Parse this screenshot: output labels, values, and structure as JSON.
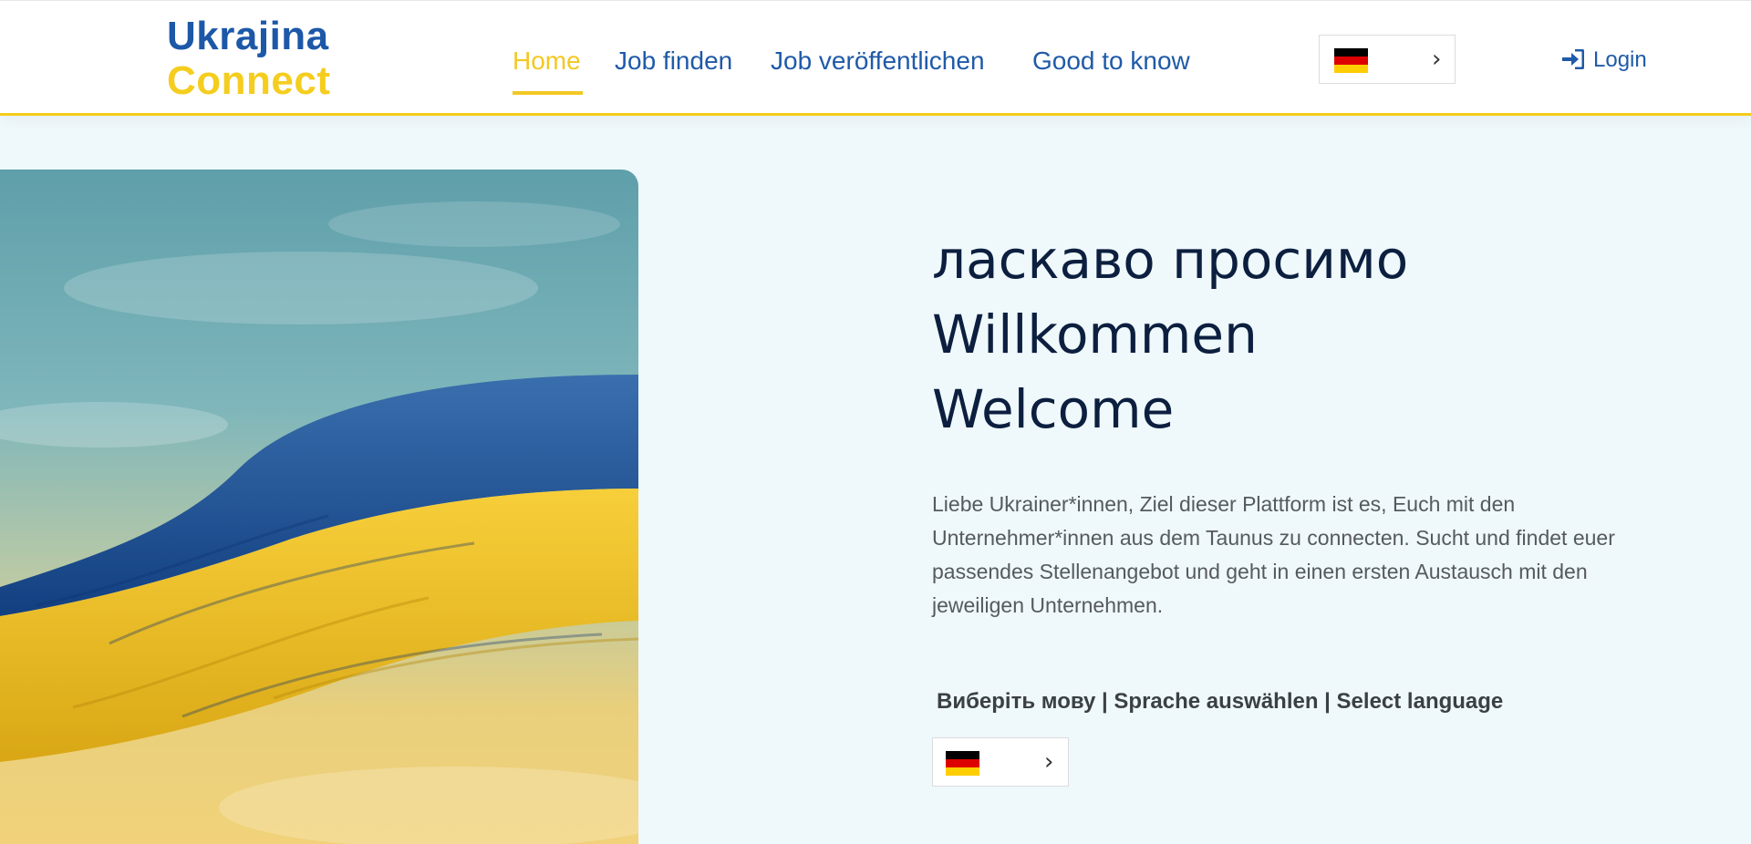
{
  "logo": {
    "line1": "Ukrajina",
    "line2": "Connect"
  },
  "nav": {
    "items": [
      {
        "label": "Home",
        "active": true
      },
      {
        "label": "Job finden",
        "active": false
      },
      {
        "label": "Job veröffentlichen",
        "active": false
      },
      {
        "label": "Good to know",
        "active": false
      }
    ],
    "language_icon": "german-flag-icon",
    "login_label": "Login",
    "login_icon": "sign-in-icon"
  },
  "hero": {
    "image": "ukrainian-flag-sky-image",
    "titles": [
      "ласкаво просимо",
      "Willkommen",
      "Welcome"
    ],
    "description": "Liebe Ukrainer*innen, Ziel dieser Plattform ist es, Euch mit den Unternehmer*innen aus dem Taunus zu connecten. Sucht und findet euer passendes Stellenangebot und geht in einen ersten Austausch mit den jeweiligen Unternehmen.",
    "select_language_label": "Виберіть мову | Sprache auswählen | Select language",
    "language_icon": "german-flag-icon"
  },
  "colors": {
    "brand_blue": "#1f5aa8",
    "brand_yellow": "#f3c823",
    "background": "#eff8fb",
    "title": "#0c1f3f"
  }
}
